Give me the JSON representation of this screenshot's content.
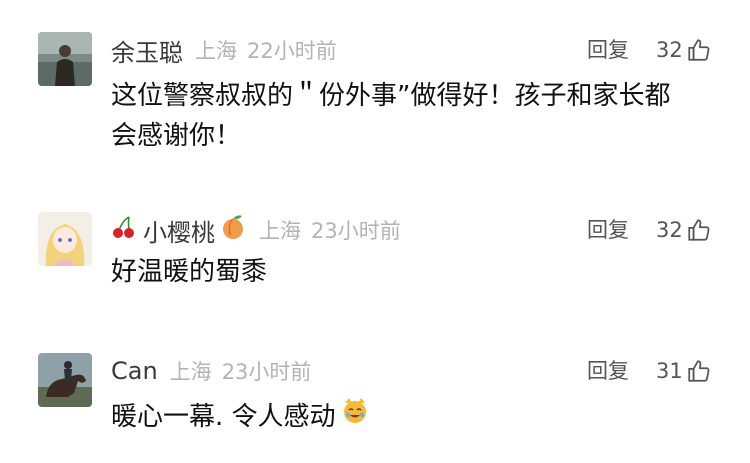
{
  "comments": [
    {
      "username": "余玉聪",
      "location": "上海",
      "time": "22小时前",
      "reply_label": "回复",
      "like_count": "32",
      "text_line1": "这位警察叔叔的＂份外事”做得好！孩子和家长都",
      "text_line2": "会感谢你！",
      "avatar_icon": "man-portrait-avatar"
    },
    {
      "username": "小樱桃",
      "username_prefix_emoji": "cherries-emoji",
      "username_suffix_emoji": "peach-emoji",
      "location": "上海",
      "time": "23小时前",
      "reply_label": "回复",
      "like_count": "32",
      "text_line1": "好温暖的蜀黍",
      "avatar_icon": "anime-girl-avatar"
    },
    {
      "username": "Can",
      "location": "上海",
      "time": "23小时前",
      "reply_label": "回复",
      "like_count": "31",
      "text_line1": "暖心一幕. 令人感动",
      "text_emoji": "crying-cat-emoji",
      "avatar_icon": "horse-rider-avatar"
    }
  ],
  "icons": {
    "like": "thumbs-up-icon"
  },
  "colors": {
    "meta_gray": "#b3b3b3",
    "username_gray": "#3a3a3a",
    "text": "#111111"
  }
}
